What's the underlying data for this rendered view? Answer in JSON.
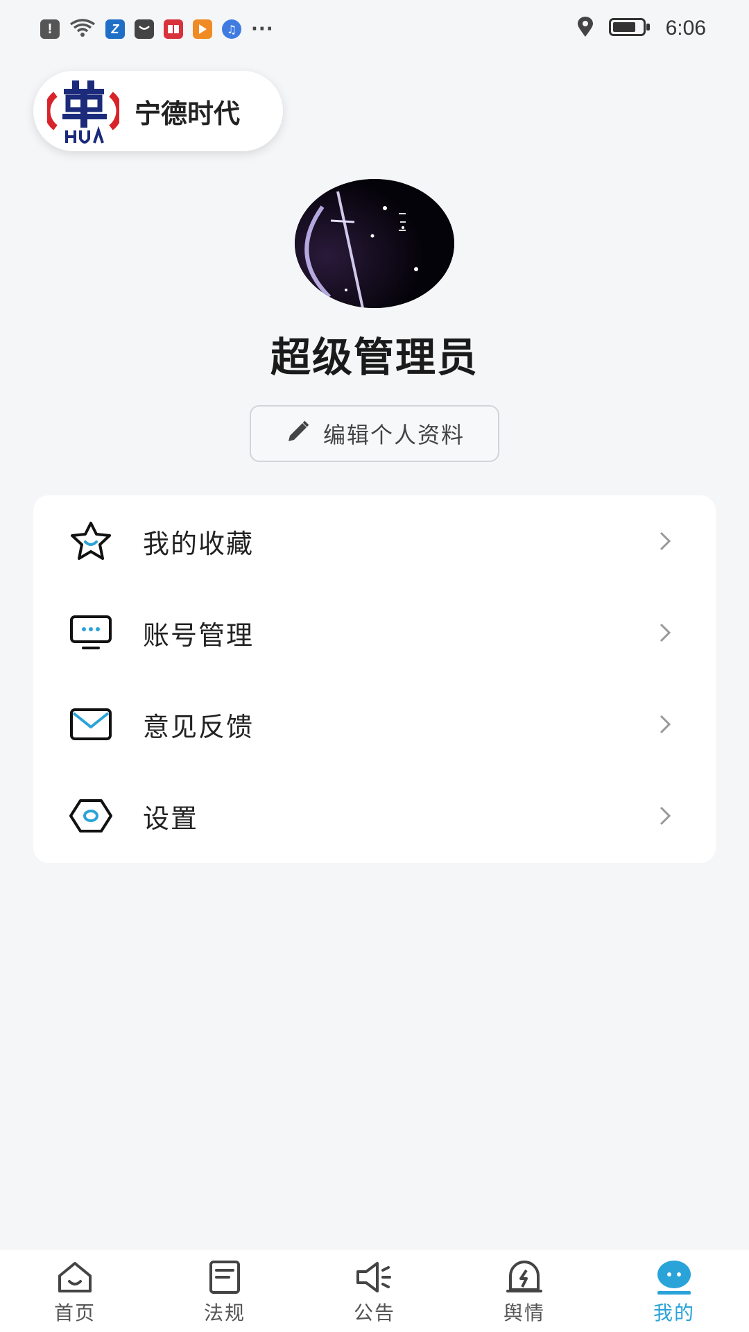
{
  "status_bar": {
    "time": "6:06",
    "left_icons": [
      "alert-icon",
      "wifi-icon",
      "app-icon",
      "huawei-icon",
      "book-icon",
      "video-icon",
      "music-icon",
      "more-icon"
    ],
    "right_icons": [
      "location-icon",
      "battery-icon"
    ]
  },
  "org": {
    "name": "宁德时代"
  },
  "profile": {
    "username": "超级管理员",
    "edit_label": "编辑个人资料"
  },
  "menu": {
    "items": [
      {
        "label": "我的收藏",
        "icon": "star-icon"
      },
      {
        "label": "账号管理",
        "icon": "monitor-icon"
      },
      {
        "label": "意见反馈",
        "icon": "mail-icon"
      },
      {
        "label": "设置",
        "icon": "settings-hex-icon"
      }
    ]
  },
  "bottom_nav": {
    "active_index": 4,
    "active_color": "#2aa3d8",
    "items": [
      {
        "label": "首页",
        "icon": "home-icon"
      },
      {
        "label": "法规",
        "icon": "document-icon"
      },
      {
        "label": "公告",
        "icon": "megaphone-icon"
      },
      {
        "label": "舆情",
        "icon": "alert-bell-icon"
      },
      {
        "label": "我的",
        "icon": "profile-icon"
      }
    ]
  }
}
